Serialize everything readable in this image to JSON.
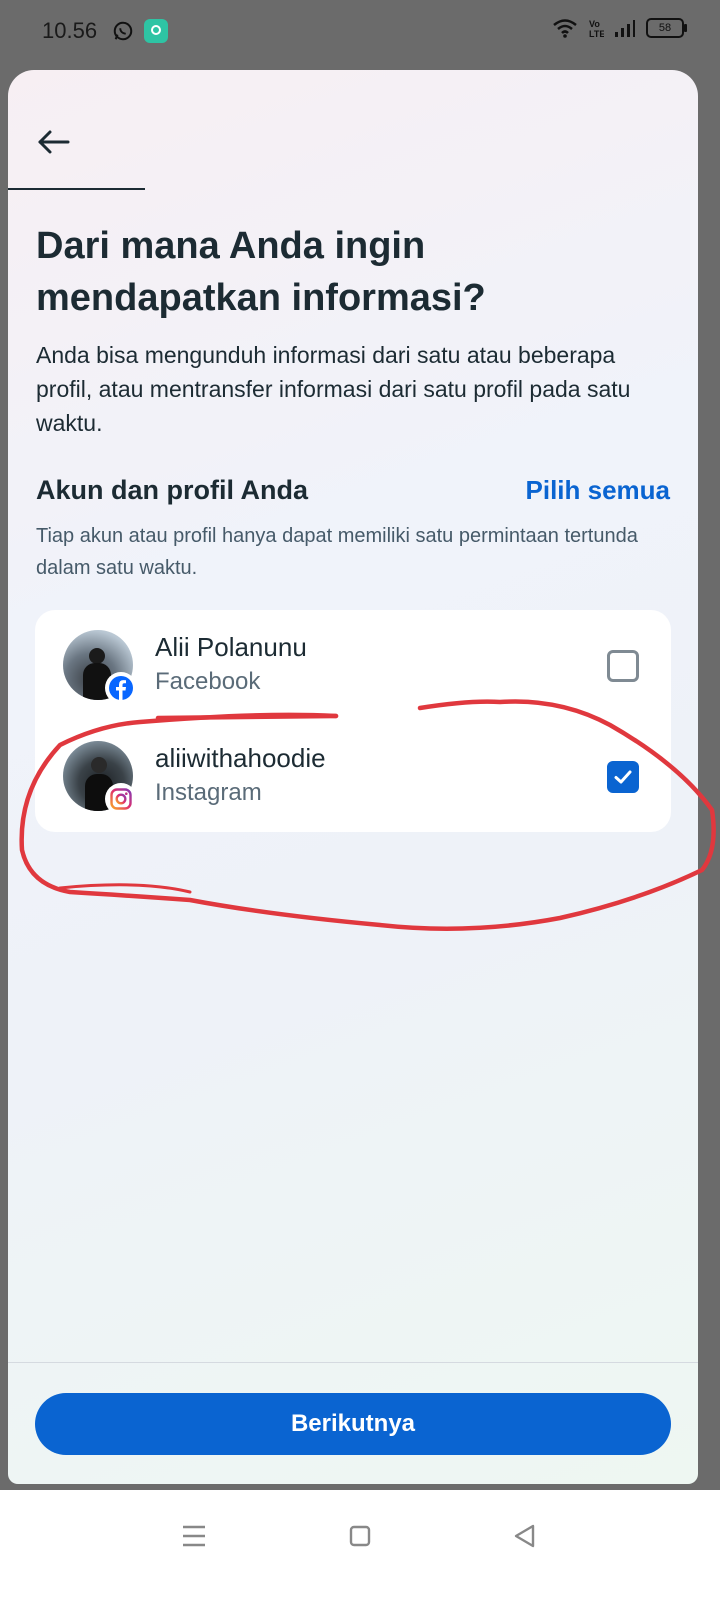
{
  "status_bar": {
    "time": "10.56",
    "battery": "58",
    "icons": [
      "whatsapp-icon",
      "app-notification-icon",
      "wifi-icon",
      "volte-icon",
      "signal-icon",
      "battery-icon"
    ]
  },
  "header": {
    "back_icon": "back-arrow-icon"
  },
  "main": {
    "title": "Dari mana Anda ingin mendapatkan informasi?",
    "description": "Anda bisa mengunduh informasi dari satu atau beberapa profil, atau mentransfer informasi dari satu profil pada satu waktu.",
    "section_title": "Akun dan profil Anda",
    "select_all_label": "Pilih semua",
    "section_note": "Tiap akun atau profil hanya dapat memiliki satu permintaan tertunda dalam satu waktu."
  },
  "accounts": [
    {
      "name": "Alii Polanunu",
      "platform": "Facebook",
      "badge_icon": "facebook-icon",
      "checked": false
    },
    {
      "name": "aliiwithahoodie",
      "platform": "Instagram",
      "badge_icon": "instagram-icon",
      "checked": true
    }
  ],
  "footer": {
    "next_label": "Berikutnya"
  },
  "nav_bar": {
    "icons": [
      "menu-icon",
      "home-square-icon",
      "back-triangle-icon"
    ]
  },
  "colors": {
    "accent": "#0a64d1",
    "annotation": "#e0383e",
    "text": "#1c2b33"
  }
}
